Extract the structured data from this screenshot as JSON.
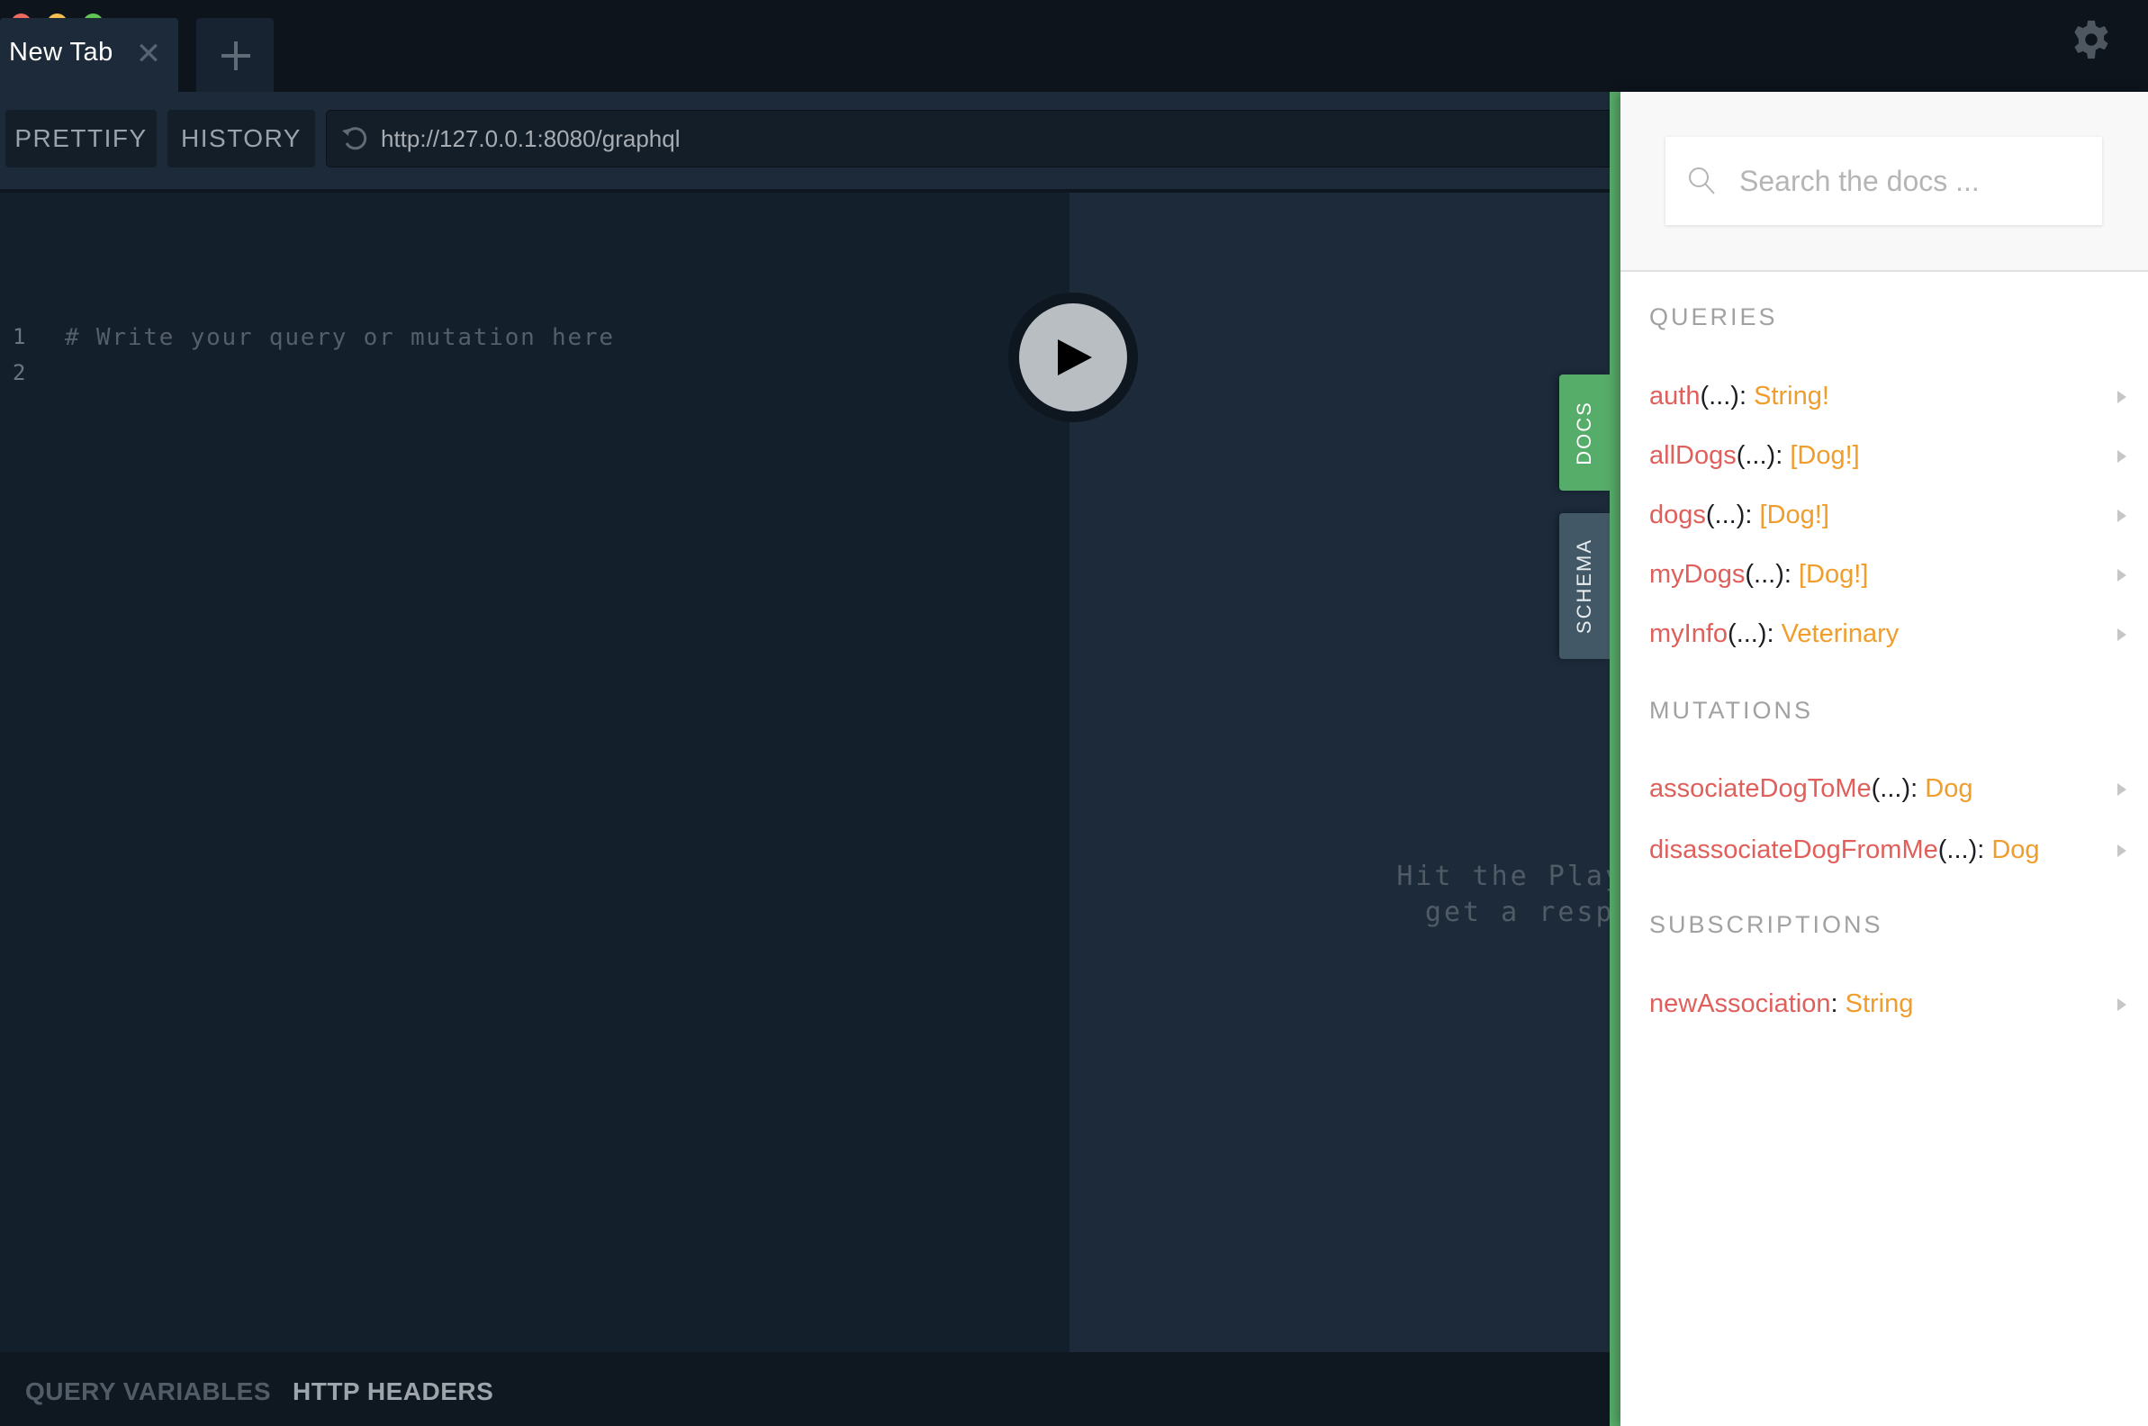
{
  "window": {
    "traffic_lights": [
      "close",
      "minimize",
      "maximize"
    ]
  },
  "tabs": [
    {
      "label": "New Tab",
      "active": true,
      "close_glyph": "✕"
    }
  ],
  "new_tab_icon": "plus-icon",
  "settings_icon": "gear-icon",
  "toolbar": {
    "prettify_label": "PRETTIFY",
    "history_label": "HISTORY",
    "reload_icon": "reload-icon",
    "endpoint_url": "http://127.0.0.1:8080/graphql"
  },
  "editor": {
    "line_numbers": [
      "1",
      "2"
    ],
    "lines": [
      "# Write your query or mutation here",
      ""
    ]
  },
  "run_button": {
    "icon": "play-icon"
  },
  "result": {
    "hint": "Hit the Play Button to\nget a response here"
  },
  "bottom_tabs": {
    "query_variables": "QUERY VARIABLES",
    "http_headers": "HTTP HEADERS"
  },
  "side_tabs": {
    "docs": "DOCS",
    "schema": "SCHEMA"
  },
  "docs": {
    "search_placeholder": "Search the docs ...",
    "sections": [
      {
        "heading": "QUERIES",
        "items": [
          {
            "name": "auth",
            "args": "(...)",
            "sep": ": ",
            "type": "String!"
          },
          {
            "name": "allDogs",
            "args": "(...)",
            "sep": ": ",
            "type": "[Dog!]"
          },
          {
            "name": "dogs",
            "args": "(...)",
            "sep": ": ",
            "type": "[Dog!]"
          },
          {
            "name": "myDogs",
            "args": "(...)",
            "sep": ": ",
            "type": "[Dog!]"
          },
          {
            "name": "myInfo",
            "args": "(...)",
            "sep": ": ",
            "type": "Veterinary"
          }
        ]
      },
      {
        "heading": "MUTATIONS",
        "items": [
          {
            "name": "associateDogToMe",
            "args": "(...)",
            "sep": ": ",
            "type": "Dog"
          },
          {
            "name": "disassociateDogFromMe",
            "args": "(...)",
            "sep": ": ",
            "type": "Dog"
          }
        ]
      },
      {
        "heading": "SUBSCRIPTIONS",
        "items": [
          {
            "name": "newAssociation",
            "args": "",
            "sep": ": ",
            "type": "String"
          }
        ]
      }
    ]
  },
  "colors": {
    "accent_green": "#58ad6a",
    "field_name": "#e05f5b",
    "field_type": "#f09d2c",
    "schema_tab": "#425867"
  }
}
